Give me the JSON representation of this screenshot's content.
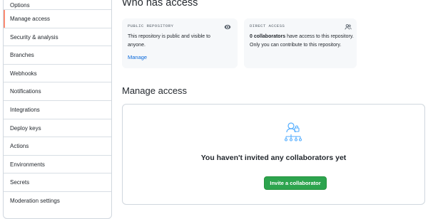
{
  "sidebar": {
    "items": [
      {
        "label": "Options"
      },
      {
        "label": "Manage access"
      },
      {
        "label": "Security & analysis"
      },
      {
        "label": "Branches"
      },
      {
        "label": "Webhooks"
      },
      {
        "label": "Notifications"
      },
      {
        "label": "Integrations"
      },
      {
        "label": "Deploy keys"
      },
      {
        "label": "Actions"
      },
      {
        "label": "Environments"
      },
      {
        "label": "Secrets"
      },
      {
        "label": "Moderation settings"
      }
    ],
    "selected": "Manage access"
  },
  "who_has_access": {
    "title": "Who has access",
    "public_card": {
      "label": "PUBLIC REPOSITORY",
      "text": "This repository is public and visible to anyone.",
      "link": "Manage",
      "icon": "eye-icon"
    },
    "direct_card": {
      "label": "DIRECT ACCESS",
      "count": "0 collaborators",
      "text": " have access to this repository. Only you can contribute to this repository.",
      "icon": "people-icon"
    }
  },
  "manage_access": {
    "title": "Manage access",
    "empty_icon": "collaborators-icon",
    "empty_message": "You haven't invited any collaborators yet",
    "invite_button": "Invite a collaborator"
  },
  "colors": {
    "accent_link": "#0969da",
    "primary_button": "#2da44e",
    "selected_marker": "#fd8c73",
    "icon_blue": "#54aeff"
  }
}
